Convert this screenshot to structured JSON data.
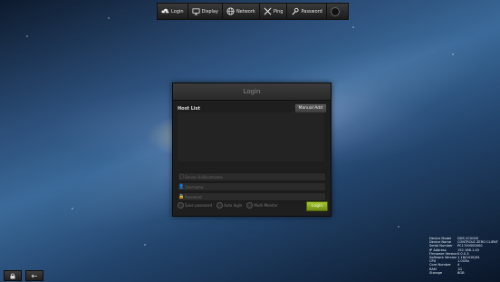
{
  "toolbar": {
    "items": [
      {
        "label": "Login",
        "icon": "upload-cloud-icon"
      },
      {
        "label": "Display",
        "icon": "monitor-icon"
      },
      {
        "label": "Network",
        "icon": "globe-icon"
      },
      {
        "label": "Ping",
        "icon": "tools-icon"
      },
      {
        "label": "Password",
        "icon": "wrench-icon"
      }
    ],
    "power_icon": "power-icon"
  },
  "dialog": {
    "title": "Login",
    "host_list_label": "Host List",
    "manual_add_label": "Manual Add",
    "server_placeholder": "Server Url/Hostname",
    "username_placeholder": "Username",
    "password_placeholder": "Password",
    "password_extra": "",
    "options": [
      "Save password",
      "Auto login",
      "Multi-Monitor"
    ],
    "login_button": "Login",
    "accent_color": "#8cb21e"
  },
  "device_info": [
    {
      "key": "Device Model",
      "value": "DDS-2C0000"
    },
    {
      "key": "Device Name",
      "value": "CONTROLE ZERO CLIENT"
    },
    {
      "key": "Serial Number",
      "value": "PC1700000000"
    },
    {
      "key": "IP Address",
      "value": "192.168.1.45"
    },
    {
      "key": "Firmware Version",
      "value": "5.0.0.3"
    },
    {
      "key": "Software Version",
      "value": "1.18(0418)94"
    },
    {
      "key": "CPU",
      "value": "1.0GHz"
    },
    {
      "key": "Core Number",
      "value": "4"
    },
    {
      "key": "RAM",
      "value": "1G"
    },
    {
      "key": "Storage",
      "value": "8GB"
    }
  ],
  "bottom_icons": [
    "lock-icon",
    "arrow-icon"
  ]
}
